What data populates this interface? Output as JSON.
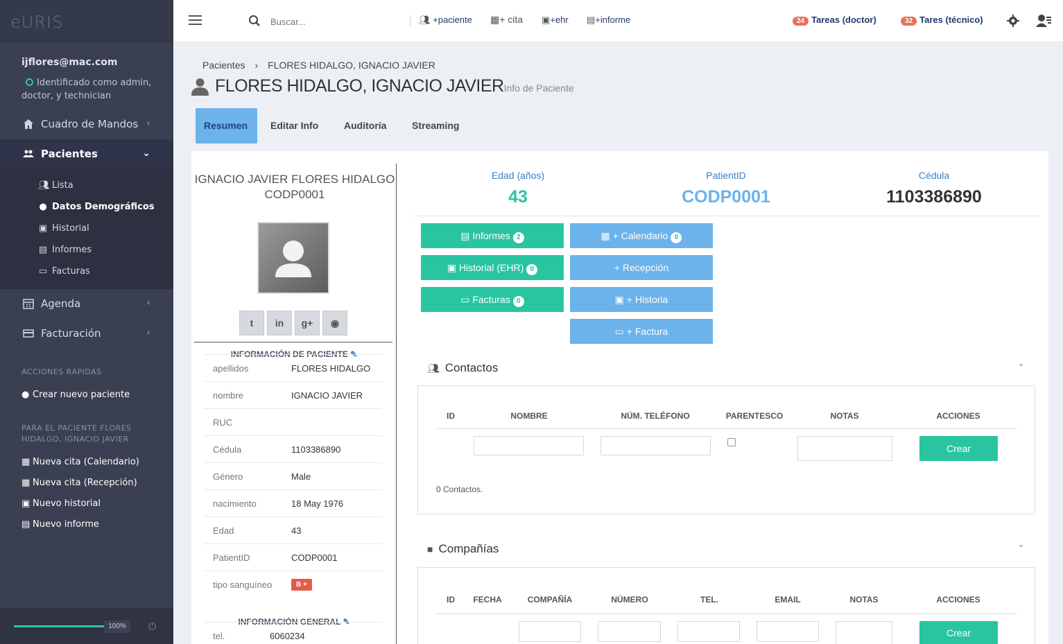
{
  "app": {
    "logo": "eURIS"
  },
  "topbar": {
    "search_placeholder": "Buscar...",
    "add_patient": "+paciente",
    "add_appointment": "+ cita",
    "add_ehr": "+ehr",
    "add_report": "+informe",
    "tasks_doctor_count": "24",
    "tasks_doctor_label": "Tareas (doctor)",
    "tasks_tech_count": "32",
    "tasks_tech_label": "Tares (técnico)"
  },
  "sidebar": {
    "email": "ijflores@mac.com",
    "status": "Identificado como admin, doctor, y technician",
    "nav": {
      "dashboard": "Cuadro de Mandos",
      "patients": "Pacientes",
      "agenda": "Agenda",
      "billing": "Facturación"
    },
    "sub": {
      "list": "Lista",
      "demographics": "Datos Demográficos",
      "history": "Historial",
      "reports": "Informes",
      "invoices": "Facturas"
    },
    "quick_title": "ACCIONES RÁPIDAS",
    "quick_create": "Crear nuevo paciente",
    "patient_title": "PARA EL PACIENTE FLORES HIDALGO, IGNACIO JAVIER",
    "patient_actions": {
      "cal": "Nueva cita (Calendario)",
      "rec": "Nueva cita (Recepción)",
      "hist": "Nuevo historial",
      "rep": "Nuevo informe"
    },
    "progress": "100%"
  },
  "breadcrumb": {
    "root": "Pacientes",
    "sep": "›",
    "current": "FLORES HIDALGO, IGNACIO JAVIER"
  },
  "header": {
    "title": "FLORES HIDALGO, IGNACIO JAVIER",
    "subtitle": "Info de Paciente"
  },
  "tabs": {
    "summary": "Resumen",
    "edit": "Editar Info",
    "audit": "Auditoría",
    "stream": "Streaming"
  },
  "profile": {
    "full_name": "IGNACIO JAVIER FLORES HIDALGO",
    "code": "CODP0001",
    "patient_info_title": "INFORMACIÓN DE PACIENTE",
    "fields": [
      {
        "k": "apellidos",
        "v": "FLORES HIDALGO"
      },
      {
        "k": "nombre",
        "v": "IGNACIO JAVIER"
      },
      {
        "k": "RUC",
        "v": ""
      },
      {
        "k": "Cédula",
        "v": "1103386890"
      },
      {
        "k": "Género",
        "v": "Male"
      },
      {
        "k": "nacimiento",
        "v": "18 May 1976"
      },
      {
        "k": "Edad",
        "v": "43"
      },
      {
        "k": "PatientID",
        "v": "CODP0001"
      }
    ],
    "blood_label": "tipo sanguíneo",
    "blood_value": "B +",
    "general_title": "INFORMACIÓN GENERAL",
    "tel_label": "tel.",
    "tel_value": "6060234"
  },
  "stats": {
    "age_label": "Edad (años)",
    "age_value": "43",
    "pid_label": "PatientID",
    "pid_value": "CODP0001",
    "ced_label": "Cédula",
    "ced_value": "1103386890"
  },
  "actions": {
    "reports": "Informes",
    "reports_count": "2",
    "ehr": "Historial (EHR)",
    "ehr_count": "0",
    "invoices": "Facturas",
    "invoices_count": "0",
    "calendar": "+ Calendario",
    "calendar_count": "0",
    "reception": "+ Recepción",
    "history": "+ Historia",
    "invoice": "+ Factura"
  },
  "contacts": {
    "title": "Contactos",
    "cols": [
      "ID",
      "NOMBRE",
      "NÚM. TELÉFONO",
      "PARENTESCO",
      "NOTAS",
      "ACCIONES"
    ],
    "create": "Crear",
    "count_text": "0 Contactos."
  },
  "companies": {
    "title": "Compañías",
    "cols": [
      "ID",
      "FECHA",
      "COMPAÑÍA",
      "NÚMERO",
      "TEL.",
      "EMAIL",
      "NOTAS",
      "ACCIONES"
    ],
    "create": "Crear"
  }
}
